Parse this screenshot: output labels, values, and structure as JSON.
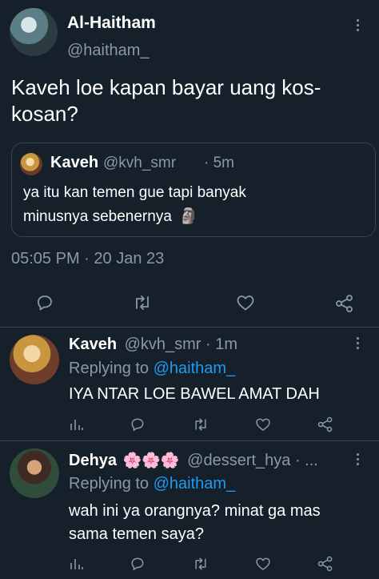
{
  "main_tweet": {
    "display_name": "Al-Haitham",
    "handle": "@haitham_",
    "text": "Kaveh loe kapan bayar uang kos-kosan?",
    "timestamp": "05:05 PM",
    "separator": "·",
    "date": "20 Jan 23"
  },
  "quoted_tweet": {
    "display_name": "Kaveh",
    "handle": "@kvh_smr",
    "age": "· 5m",
    "text_line1": "ya itu kan temen gue tapi banyak",
    "text_line2": "minusnya sebenernya",
    "emoji": "🗿"
  },
  "replies": [
    {
      "display_name": "Kaveh",
      "handle": "@kvh_smr",
      "age": "· 1m",
      "replying_prefix": "Replying to",
      "replying_handle": "@haitham_",
      "text": "IYA NTAR LOE BAWEL AMAT DAH"
    },
    {
      "display_name": "Dehya",
      "flowers": "🌸🌸🌸",
      "handle": "@dessert_hya · ...",
      "replying_prefix": "Replying to",
      "replying_handle": "@haitham_",
      "text_line1": "wah ini ya orangnya? minat ga mas",
      "text_line2": "sama temen saya?"
    }
  ],
  "icons": [
    "more-icon",
    "reply-icon",
    "retweet-icon",
    "like-icon",
    "share-icon",
    "analytics-icon"
  ],
  "colors": {
    "background": "#15202b",
    "muted": "#8b98a5",
    "link": "#1d9bf0",
    "border": "#38444d"
  }
}
